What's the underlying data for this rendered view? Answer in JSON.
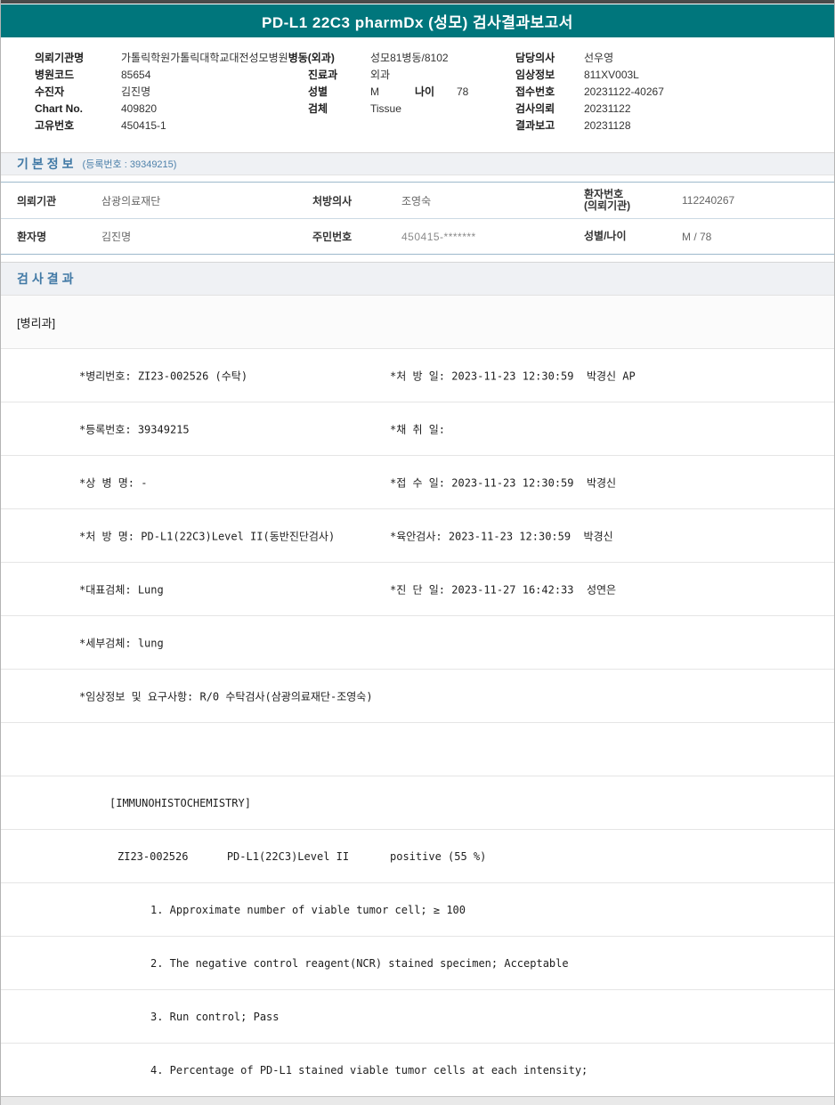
{
  "page": {
    "title": "PD-L1 22C3 pharmDx (성모) 검사결과보고서"
  },
  "colors": {
    "header_teal": "#00767c",
    "section_blue": "#4179a5",
    "top_edge": "#4a4a4a"
  },
  "patient_header": {
    "row1": {
      "label1": "의뢰기관명",
      "value1": "가톨릭학원가톨릭대학교대전성모병원",
      "value1_bold": "병동(외과)",
      "value2": "성모81병동/8102",
      "label3": "담당의사",
      "value3": "선우영"
    },
    "row2": {
      "label1": "병원코드",
      "value1": "85654",
      "label2": "진료과",
      "value2": "외과",
      "label3": "임상정보",
      "value3": "811XV003L"
    },
    "row3": {
      "label1": "수진자",
      "value1": "김진명",
      "label2": "성별",
      "value2": "M",
      "label2b": "나이",
      "value2b": "78",
      "label3": "접수번호",
      "value3": "20231122-40267"
    },
    "row4": {
      "label1": "Chart No.",
      "value1": "409820",
      "label2": "검체",
      "value2": "Tissue",
      "label3": "검사의뢰",
      "value3": "20231122"
    },
    "row5": {
      "label1": "고유번호",
      "value1": "450415-1",
      "label3": "결과보고",
      "value3": "20231128"
    }
  },
  "basic_info": {
    "title": "기본정보",
    "subtitle": "(등록번호 : 39349215)",
    "table": {
      "row1": {
        "l1": "의뢰기관",
        "v1": "삼광의료재단",
        "l2": "처방의사",
        "v2": "조영숙",
        "l3": "환자번호",
        "l3sub": "(의뢰기관)",
        "v3": "112240267"
      },
      "row2": {
        "l1": "환자명",
        "v1": "김진명",
        "l2": "주민번호",
        "v2": "450415-*******",
        "l3": "성별/나이",
        "l3sub": "",
        "v3": "M / 78"
      }
    }
  },
  "result_section": {
    "title": "검사결과"
  },
  "report": {
    "rows": [
      {
        "left": "[병리과]",
        "right": ""
      },
      {
        "left": "*병리번호: ZI23-002526 (수탁)",
        "right": "*처 방 일: 2023-11-23 12:30:59  박경신 AP"
      },
      {
        "left": "*등록번호: 39349215",
        "right": "*채 취 일:"
      },
      {
        "left": "*상 병 명: -",
        "right": "*접 수 일: 2023-11-23 12:30:59  박경신"
      },
      {
        "left": "*처 방 명: PD-L1(22C3)Level II(동반진단검사)",
        "right": "*육안검사: 2023-11-23 12:30:59  박경신"
      },
      {
        "left": "*대표검체: Lung",
        "right": "*진 단 일: 2023-11-27 16:42:33  성연은"
      },
      {
        "left": "*세부검체: lung",
        "right": ""
      },
      {
        "left": "*임상정보 및 요구사항: R/0 수탁검사(삼광의료재단-조영숙)",
        "right": ""
      },
      {
        "left": "",
        "right": ""
      },
      {
        "left": "[IMMUNOHISTOCHEMISTRY]",
        "right": ""
      },
      {
        "left": "ZI23-002526      PD-L1(22C3)Level II",
        "right": "positive (55 %)"
      },
      {
        "left": "1. Approximate number of viable tumor cell; ≥ 100",
        "right": ""
      },
      {
        "left": "2. The negative control reagent(NCR) stained specimen; Acceptable",
        "right": ""
      },
      {
        "left": "3. Run control; Pass",
        "right": ""
      },
      {
        "left": "4. Percentage of PD-L1 stained viable tumor cells at each intensity;",
        "right": ""
      }
    ]
  }
}
